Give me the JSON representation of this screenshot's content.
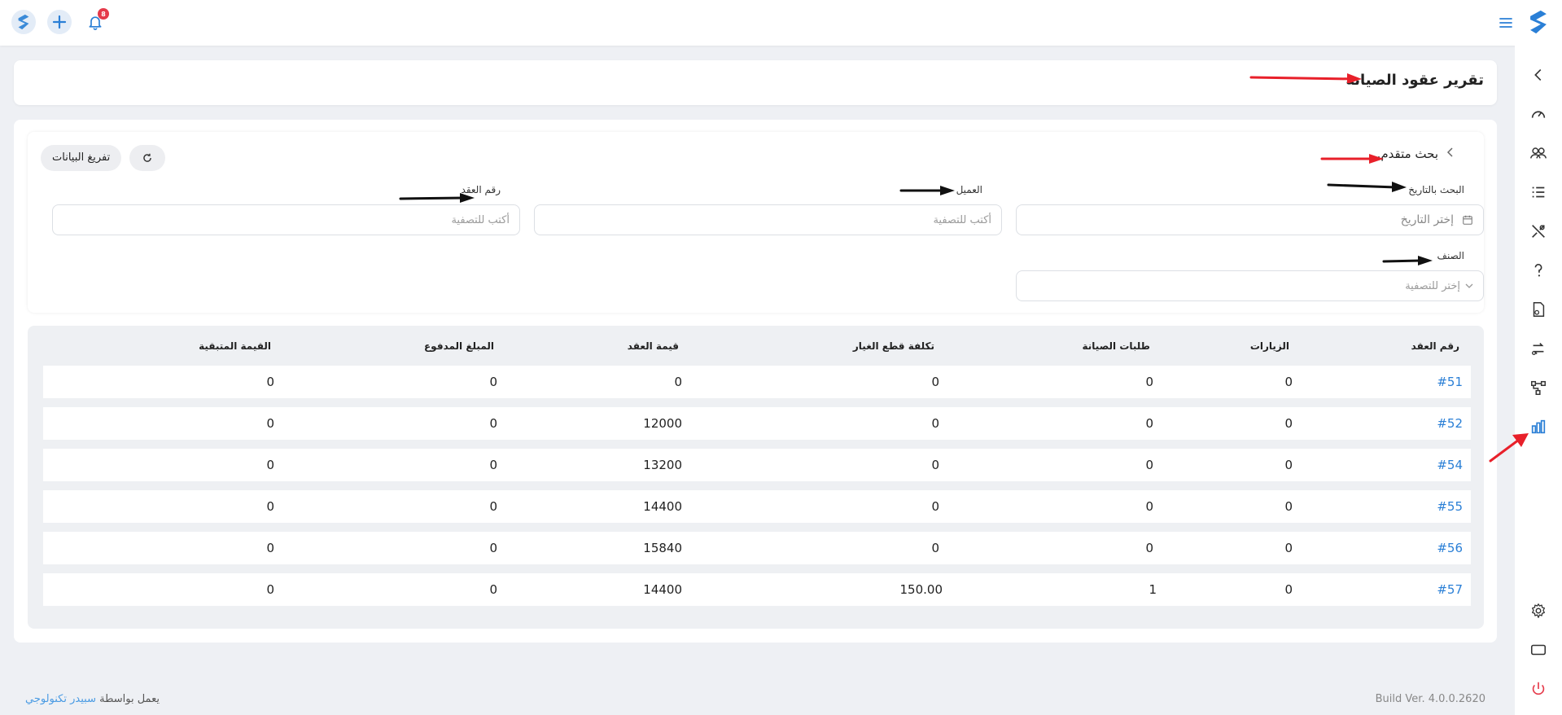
{
  "topbar": {
    "notifications_count": "8"
  },
  "page": {
    "title": "تقرير عقود الصيانة"
  },
  "filters": {
    "advanced_search_label": "بحث متقدم...",
    "clear_label": "تفريغ البيانات",
    "date_label": "البحث بالتاريخ",
    "date_placeholder": "إختر التاريخ",
    "client_label": "العميل",
    "client_placeholder": "أكتب للتصفية",
    "contract_label": "رقم العقد",
    "contract_placeholder": "أكتب للتصفية",
    "category_label": "الصنف",
    "category_placeholder": "إختر للتصفية"
  },
  "table": {
    "headers": {
      "contract_no": "رقم العقد",
      "visits": "الزيارات",
      "requests": "طلبات الصيانة",
      "parts_cost": "تكلفة قطع الغيار",
      "contract_value": "قيمة العقد",
      "paid": "المبلغ المدفوع",
      "remaining": "القيمة المتبقية"
    },
    "rows": [
      {
        "contract_no": "#51",
        "visits": "0",
        "requests": "0",
        "parts_cost": "0",
        "contract_value": "0",
        "paid": "0",
        "remaining": "0"
      },
      {
        "contract_no": "#52",
        "visits": "0",
        "requests": "0",
        "parts_cost": "0",
        "contract_value": "12000",
        "paid": "0",
        "remaining": "0"
      },
      {
        "contract_no": "#54",
        "visits": "0",
        "requests": "0",
        "parts_cost": "0",
        "contract_value": "13200",
        "paid": "0",
        "remaining": "0"
      },
      {
        "contract_no": "#55",
        "visits": "0",
        "requests": "0",
        "parts_cost": "0",
        "contract_value": "14400",
        "paid": "0",
        "remaining": "0"
      },
      {
        "contract_no": "#56",
        "visits": "0",
        "requests": "0",
        "parts_cost": "0",
        "contract_value": "15840",
        "paid": "0",
        "remaining": "0"
      },
      {
        "contract_no": "#57",
        "visits": "0",
        "requests": "1",
        "parts_cost": "150.00",
        "contract_value": "14400",
        "paid": "0",
        "remaining": "0"
      }
    ]
  },
  "footer": {
    "powered_by": "يعمل بواسطة",
    "company": "سبيدر تكنولوجي",
    "build": "Build Ver. 4.0.0.2620"
  },
  "colors": {
    "accent": "#2a7fd6",
    "red_arrow": "#e8202a",
    "active_icon": "#2a7fd6"
  }
}
